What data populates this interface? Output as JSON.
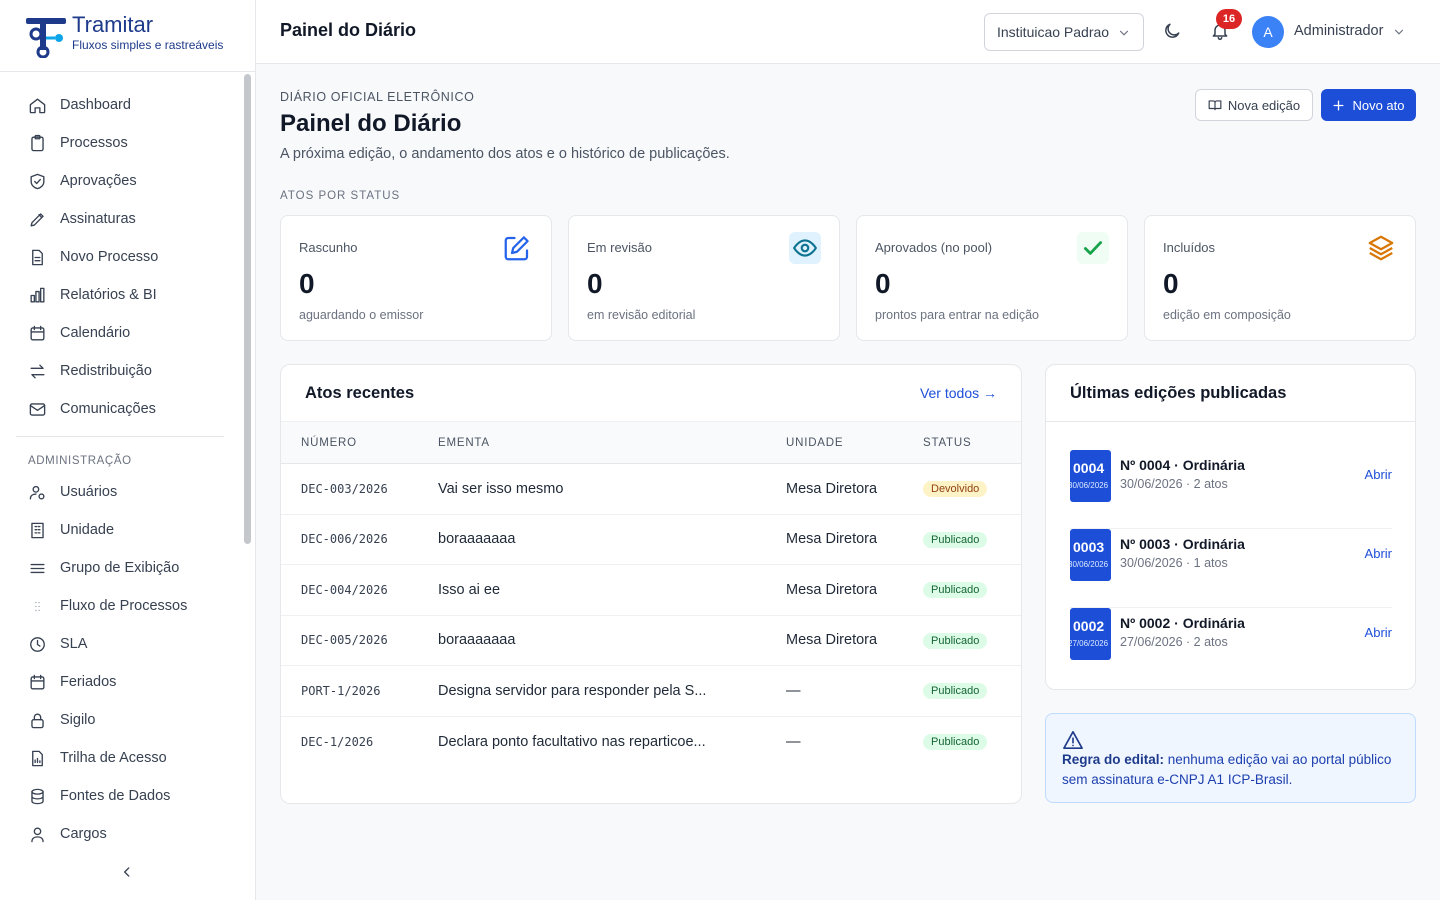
{
  "app": {
    "name": "Tramitar",
    "tagline": "Fluxos simples e rastreáveis"
  },
  "sidebar": {
    "items": [
      {
        "label": "Dashboard",
        "icon": "home-icon"
      },
      {
        "label": "Processos",
        "icon": "clipboard-icon"
      },
      {
        "label": "Aprovações",
        "icon": "shield-check-icon"
      },
      {
        "label": "Assinaturas",
        "icon": "pen-icon"
      },
      {
        "label": "Novo Processo",
        "icon": "file-icon"
      },
      {
        "label": "Relatórios & BI",
        "icon": "bar-chart-icon"
      },
      {
        "label": "Calendário",
        "icon": "calendar-icon"
      },
      {
        "label": "Redistribuição",
        "icon": "swap-icon"
      },
      {
        "label": "Comunicações",
        "icon": "mail-icon"
      }
    ],
    "admin_section": "ADMINISTRAÇÃO",
    "admin_items": [
      {
        "label": "Usuários",
        "icon": "users-icon"
      },
      {
        "label": "Unidade",
        "icon": "building-icon"
      },
      {
        "label": "Grupo de Exibição",
        "icon": "list-icon"
      },
      {
        "label": "Fluxo de Processos",
        "icon": "grid-dots-icon"
      },
      {
        "label": "SLA",
        "icon": "clock-icon"
      },
      {
        "label": "Feriados",
        "icon": "calendar-icon"
      },
      {
        "label": "Sigilo",
        "icon": "lock-icon"
      },
      {
        "label": "Trilha de Acesso",
        "icon": "file-chart-icon"
      },
      {
        "label": "Fontes de Dados",
        "icon": "database-icon"
      },
      {
        "label": "Cargos",
        "icon": "person-icon"
      }
    ]
  },
  "topbar": {
    "title": "Painel do Diário",
    "institution": "Instituicao Padrao",
    "notifications": "16",
    "avatar_initial": "A",
    "user_name": "Administrador"
  },
  "header": {
    "eyebrow": "DIÁRIO OFICIAL ELETRÔNICO",
    "title": "Painel do Diário",
    "subtitle": "A próxima edição, o andamento dos atos e o histórico de publicações.",
    "btn_new_edition": "Nova edição",
    "btn_new_act": "Novo ato"
  },
  "status": {
    "section_label": "ATOS POR STATUS",
    "cards": [
      {
        "label": "Rascunho",
        "value": "0",
        "desc": "aguardando o emissor",
        "icon": "edit-icon",
        "color": "#2563eb"
      },
      {
        "label": "Em revisão",
        "value": "0",
        "desc": "em revisão editorial",
        "icon": "eye-icon",
        "color": "#0e7490"
      },
      {
        "label": "Aprovados (no pool)",
        "value": "0",
        "desc": "prontos para entrar na edição",
        "icon": "check-icon",
        "color": "#16a34a"
      },
      {
        "label": "Incluídos",
        "value": "0",
        "desc": "edição em composição",
        "icon": "layers-icon",
        "color": "#d97706"
      }
    ]
  },
  "recent": {
    "title": "Atos recentes",
    "see_all": "Ver todos →",
    "columns": [
      "NÚMERO",
      "EMENTA",
      "UNIDADE",
      "STATUS"
    ],
    "rows": [
      {
        "numero": "DEC-003/2026",
        "ementa": "Vai ser isso mesmo",
        "unidade": "Mesa Diretora",
        "status": "Devolvido"
      },
      {
        "numero": "DEC-006/2026",
        "ementa": "boraaaaaaa",
        "unidade": "Mesa Diretora",
        "status": "Publicado"
      },
      {
        "numero": "DEC-004/2026",
        "ementa": "Isso ai ee",
        "unidade": "Mesa Diretora",
        "status": "Publicado"
      },
      {
        "numero": "DEC-005/2026",
        "ementa": "boraaaaaaa",
        "unidade": "Mesa Diretora",
        "status": "Publicado"
      },
      {
        "numero": "PORT-1/2026",
        "ementa": "Designa servidor para responder pela S...",
        "unidade": "—",
        "status": "Publicado"
      },
      {
        "numero": "DEC-1/2026",
        "ementa": "Declara ponto facultativo nas reparticoe...",
        "unidade": "—",
        "status": "Publicado"
      }
    ]
  },
  "editions": {
    "title": "Últimas edições publicadas",
    "items": [
      {
        "thumb": "0004",
        "thumb_date": "30/06/2026",
        "title": "Nº 0004 · Ordinária",
        "meta": "30/06/2026 · 2 atos",
        "action": "Abrir"
      },
      {
        "thumb": "0003",
        "thumb_date": "30/06/2026",
        "title": "Nº 0003 · Ordinária",
        "meta": "30/06/2026 · 1 atos",
        "action": "Abrir"
      },
      {
        "thumb": "0002",
        "thumb_date": "27/06/2026",
        "title": "Nº 0002 · Ordinária",
        "meta": "27/06/2026 · 2 atos",
        "action": "Abrir"
      }
    ]
  },
  "notice": {
    "strong": "Regra do edital:",
    "text": " nenhuma edição vai ao portal público sem assinatura e-CNPJ A1 ICP-Brasil."
  }
}
